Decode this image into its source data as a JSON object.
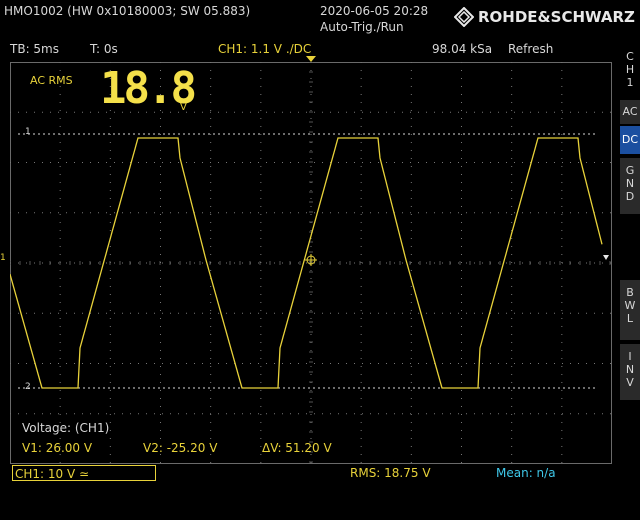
{
  "header": {
    "device_info": "HMO1002 (HW 0x10180003; SW 05.883)",
    "date_time": "2020-06-05 20:28",
    "trigger_mode": "Auto-Trig./Run",
    "brand": "ROHDE&SCHWARZ"
  },
  "settings": {
    "timebase": "TB: 5ms",
    "trigger_time": "T: 0s",
    "channel": "CH1: 1.1 V ./DC",
    "sample_rate": "98.04 kSa",
    "acq_mode": "Refresh"
  },
  "side_menu": {
    "channel_tab": [
      "C",
      "H",
      "1"
    ],
    "ac": "AC",
    "dc": "DC",
    "gnd": [
      "G",
      "N",
      "D"
    ],
    "bwl": [
      "B",
      "W",
      "L"
    ],
    "inv": [
      "I",
      "N",
      "V"
    ]
  },
  "measurement": {
    "label": "AC RMS",
    "value": "18.8",
    "unit": "V"
  },
  "markers": {
    "cursor1": "1",
    "cursor2": "2",
    "channel1": "1"
  },
  "cursors": {
    "title": "Voltage: (CH1)",
    "v1": "V1: 26.00 V",
    "v2": "V2: -25.20 V",
    "dv": "ΔV: 51.20 V"
  },
  "bottom": {
    "channel_scale": "CH1: 10 V ≃",
    "rms": "RMS: 18.75 V",
    "mean": "Mean: n/a"
  },
  "colors": {
    "trace": "#e8d23a",
    "grid": "#5a5a5a",
    "accent_blue": "#1b4fa0",
    "mean_cyan": "#3ec7e8"
  }
}
